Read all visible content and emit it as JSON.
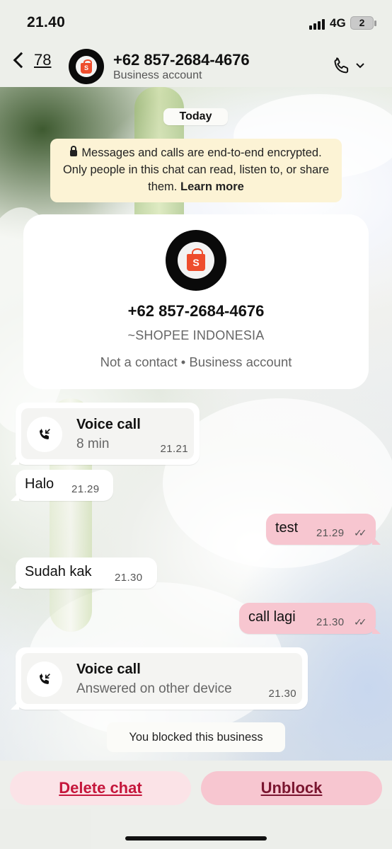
{
  "status_bar": {
    "time": "21.40",
    "network": "4G",
    "battery": "2"
  },
  "header": {
    "back_count": "78",
    "contact_name": "+62 857-2684-4676",
    "contact_subtitle": "Business account",
    "avatar_letter": "S"
  },
  "chat": {
    "date_chip": "Today",
    "encryption_notice": "Messages and calls are end-to-end encrypted. Only people in this chat can read, listen to, or share them.",
    "encryption_link": "Learn more",
    "profile_card": {
      "avatar_letter": "S",
      "phone": "+62 857-2684-4676",
      "name": "~SHOPEE INDONESIA",
      "status": "Not a contact • Business account"
    },
    "messages": [
      {
        "kind": "call",
        "direction": "in",
        "title": "Voice call",
        "subtitle": "8 min",
        "time": "21.21"
      },
      {
        "kind": "text",
        "direction": "in",
        "text": "Halo",
        "time": "21.29"
      },
      {
        "kind": "text",
        "direction": "out",
        "text": "test",
        "time": "21.29",
        "ticks": "✓✓"
      },
      {
        "kind": "text",
        "direction": "in",
        "text": "Sudah kak",
        "time": "21.30"
      },
      {
        "kind": "text",
        "direction": "out",
        "text": "call lagi",
        "time": "21.30",
        "ticks": "✓✓"
      },
      {
        "kind": "call",
        "direction": "in",
        "title": "Voice call",
        "subtitle": "Answered on other device",
        "time": "21.30"
      }
    ],
    "system_message": "You blocked this business"
  },
  "bottom": {
    "delete_label": "Delete chat",
    "unblock_label": "Unblock"
  },
  "colors": {
    "outgoing_bubble": "#f7c6d0",
    "delete_text": "#c5163b",
    "unblock_text": "#7a1630",
    "brand_orange": "#ee4d2d",
    "encryption_bg": "#fcf3d5"
  },
  "icons": [
    "back-chevron-icon",
    "shopee-bag-icon",
    "phone-icon",
    "chevron-down-icon",
    "lock-icon",
    "incoming-call-icon",
    "double-check-icon",
    "signal-icon",
    "battery-icon"
  ]
}
